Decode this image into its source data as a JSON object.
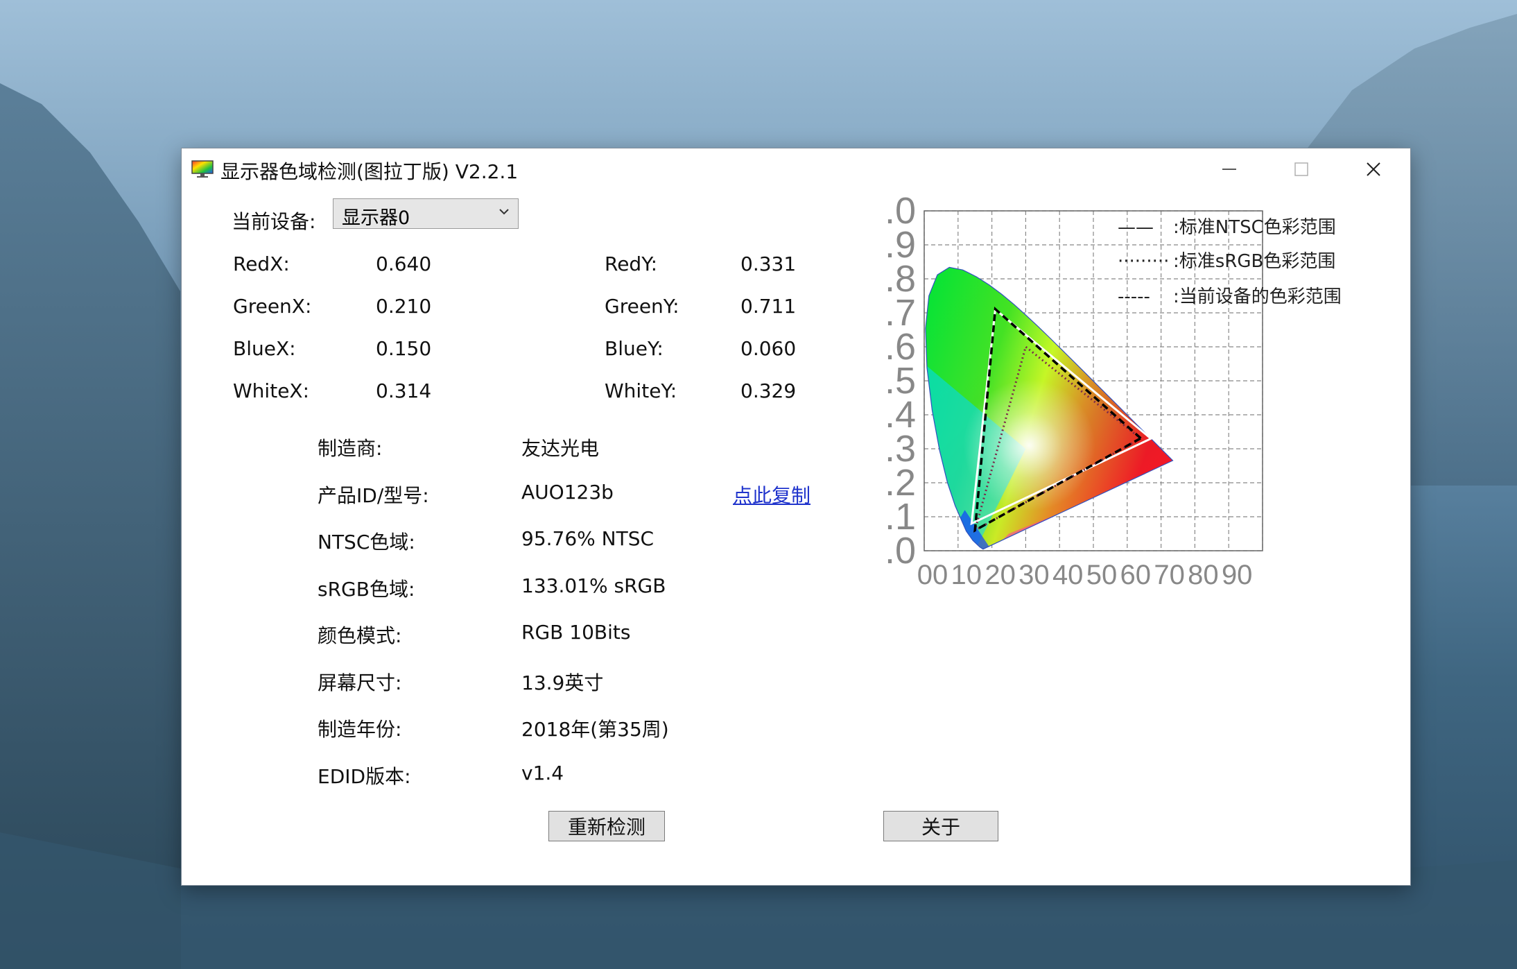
{
  "window": {
    "title": "显示器色域检测(图拉丁版) V2.2.1"
  },
  "device": {
    "label": "当前设备:",
    "selected": "显示器0"
  },
  "coords": [
    {
      "lx": "RedX:",
      "vx": "0.640",
      "ly": "RedY:",
      "vy": "0.331"
    },
    {
      "lx": "GreenX:",
      "vx": "0.210",
      "ly": "GreenY:",
      "vy": "0.711"
    },
    {
      "lx": "BlueX:",
      "vx": "0.150",
      "ly": "BlueY:",
      "vy": "0.060"
    },
    {
      "lx": "WhiteX:",
      "vx": "0.314",
      "ly": "WhiteY:",
      "vy": "0.329"
    }
  ],
  "info": [
    {
      "label": "制造商:",
      "value": "友达光电"
    },
    {
      "label": "产品ID/型号:",
      "value": "AUO123b"
    },
    {
      "label": "NTSC色域:",
      "value": "95.76% NTSC"
    },
    {
      "label": "sRGB色域:",
      "value": "133.01% sRGB"
    },
    {
      "label": "颜色模式:",
      "value": "RGB 10Bits"
    },
    {
      "label": "屏幕尺寸:",
      "value": "13.9英寸"
    },
    {
      "label": "制造年份:",
      "value": "2018年(第35周)"
    },
    {
      "label": "EDID版本:",
      "value": "v1.4"
    }
  ],
  "copy_link": "点此复制",
  "buttons": {
    "redetect": "重新检测",
    "about": "关于"
  },
  "chart_data": {
    "type": "scatter",
    "title": "",
    "y_ticks": [
      ".0",
      ".9",
      ".8",
      ".7",
      ".6",
      ".5",
      ".4",
      ".3",
      ".2",
      ".1",
      ".0"
    ],
    "x_ticks": [
      "00",
      "10",
      "20",
      "30",
      "40",
      "50",
      "60",
      "70",
      "80",
      "90"
    ],
    "xlim": [
      0,
      1.0
    ],
    "ylim": [
      0,
      1.0
    ],
    "grid": true,
    "legend": [
      {
        "symbol": "——",
        "text": ":标准NTSC色彩范围"
      },
      {
        "symbol": "·········",
        "text": ":标准sRGB色彩范围"
      },
      {
        "symbol": "-----",
        "text": ":当前设备的色彩范围"
      }
    ],
    "series": [
      {
        "name": "标准NTSC色彩范围",
        "style": "solid",
        "color": "#ffffff",
        "points": [
          [
            0.67,
            0.33
          ],
          [
            0.21,
            0.71
          ],
          [
            0.14,
            0.08
          ]
        ]
      },
      {
        "name": "标准sRGB色彩范围",
        "style": "dotted",
        "color": "#7a2a4a",
        "points": [
          [
            0.64,
            0.33
          ],
          [
            0.3,
            0.6
          ],
          [
            0.15,
            0.06
          ]
        ]
      },
      {
        "name": "当前设备的色彩范围",
        "style": "dashed",
        "color": "#000000",
        "points": [
          [
            0.64,
            0.331
          ],
          [
            0.21,
            0.711
          ],
          [
            0.15,
            0.06
          ]
        ]
      }
    ]
  }
}
